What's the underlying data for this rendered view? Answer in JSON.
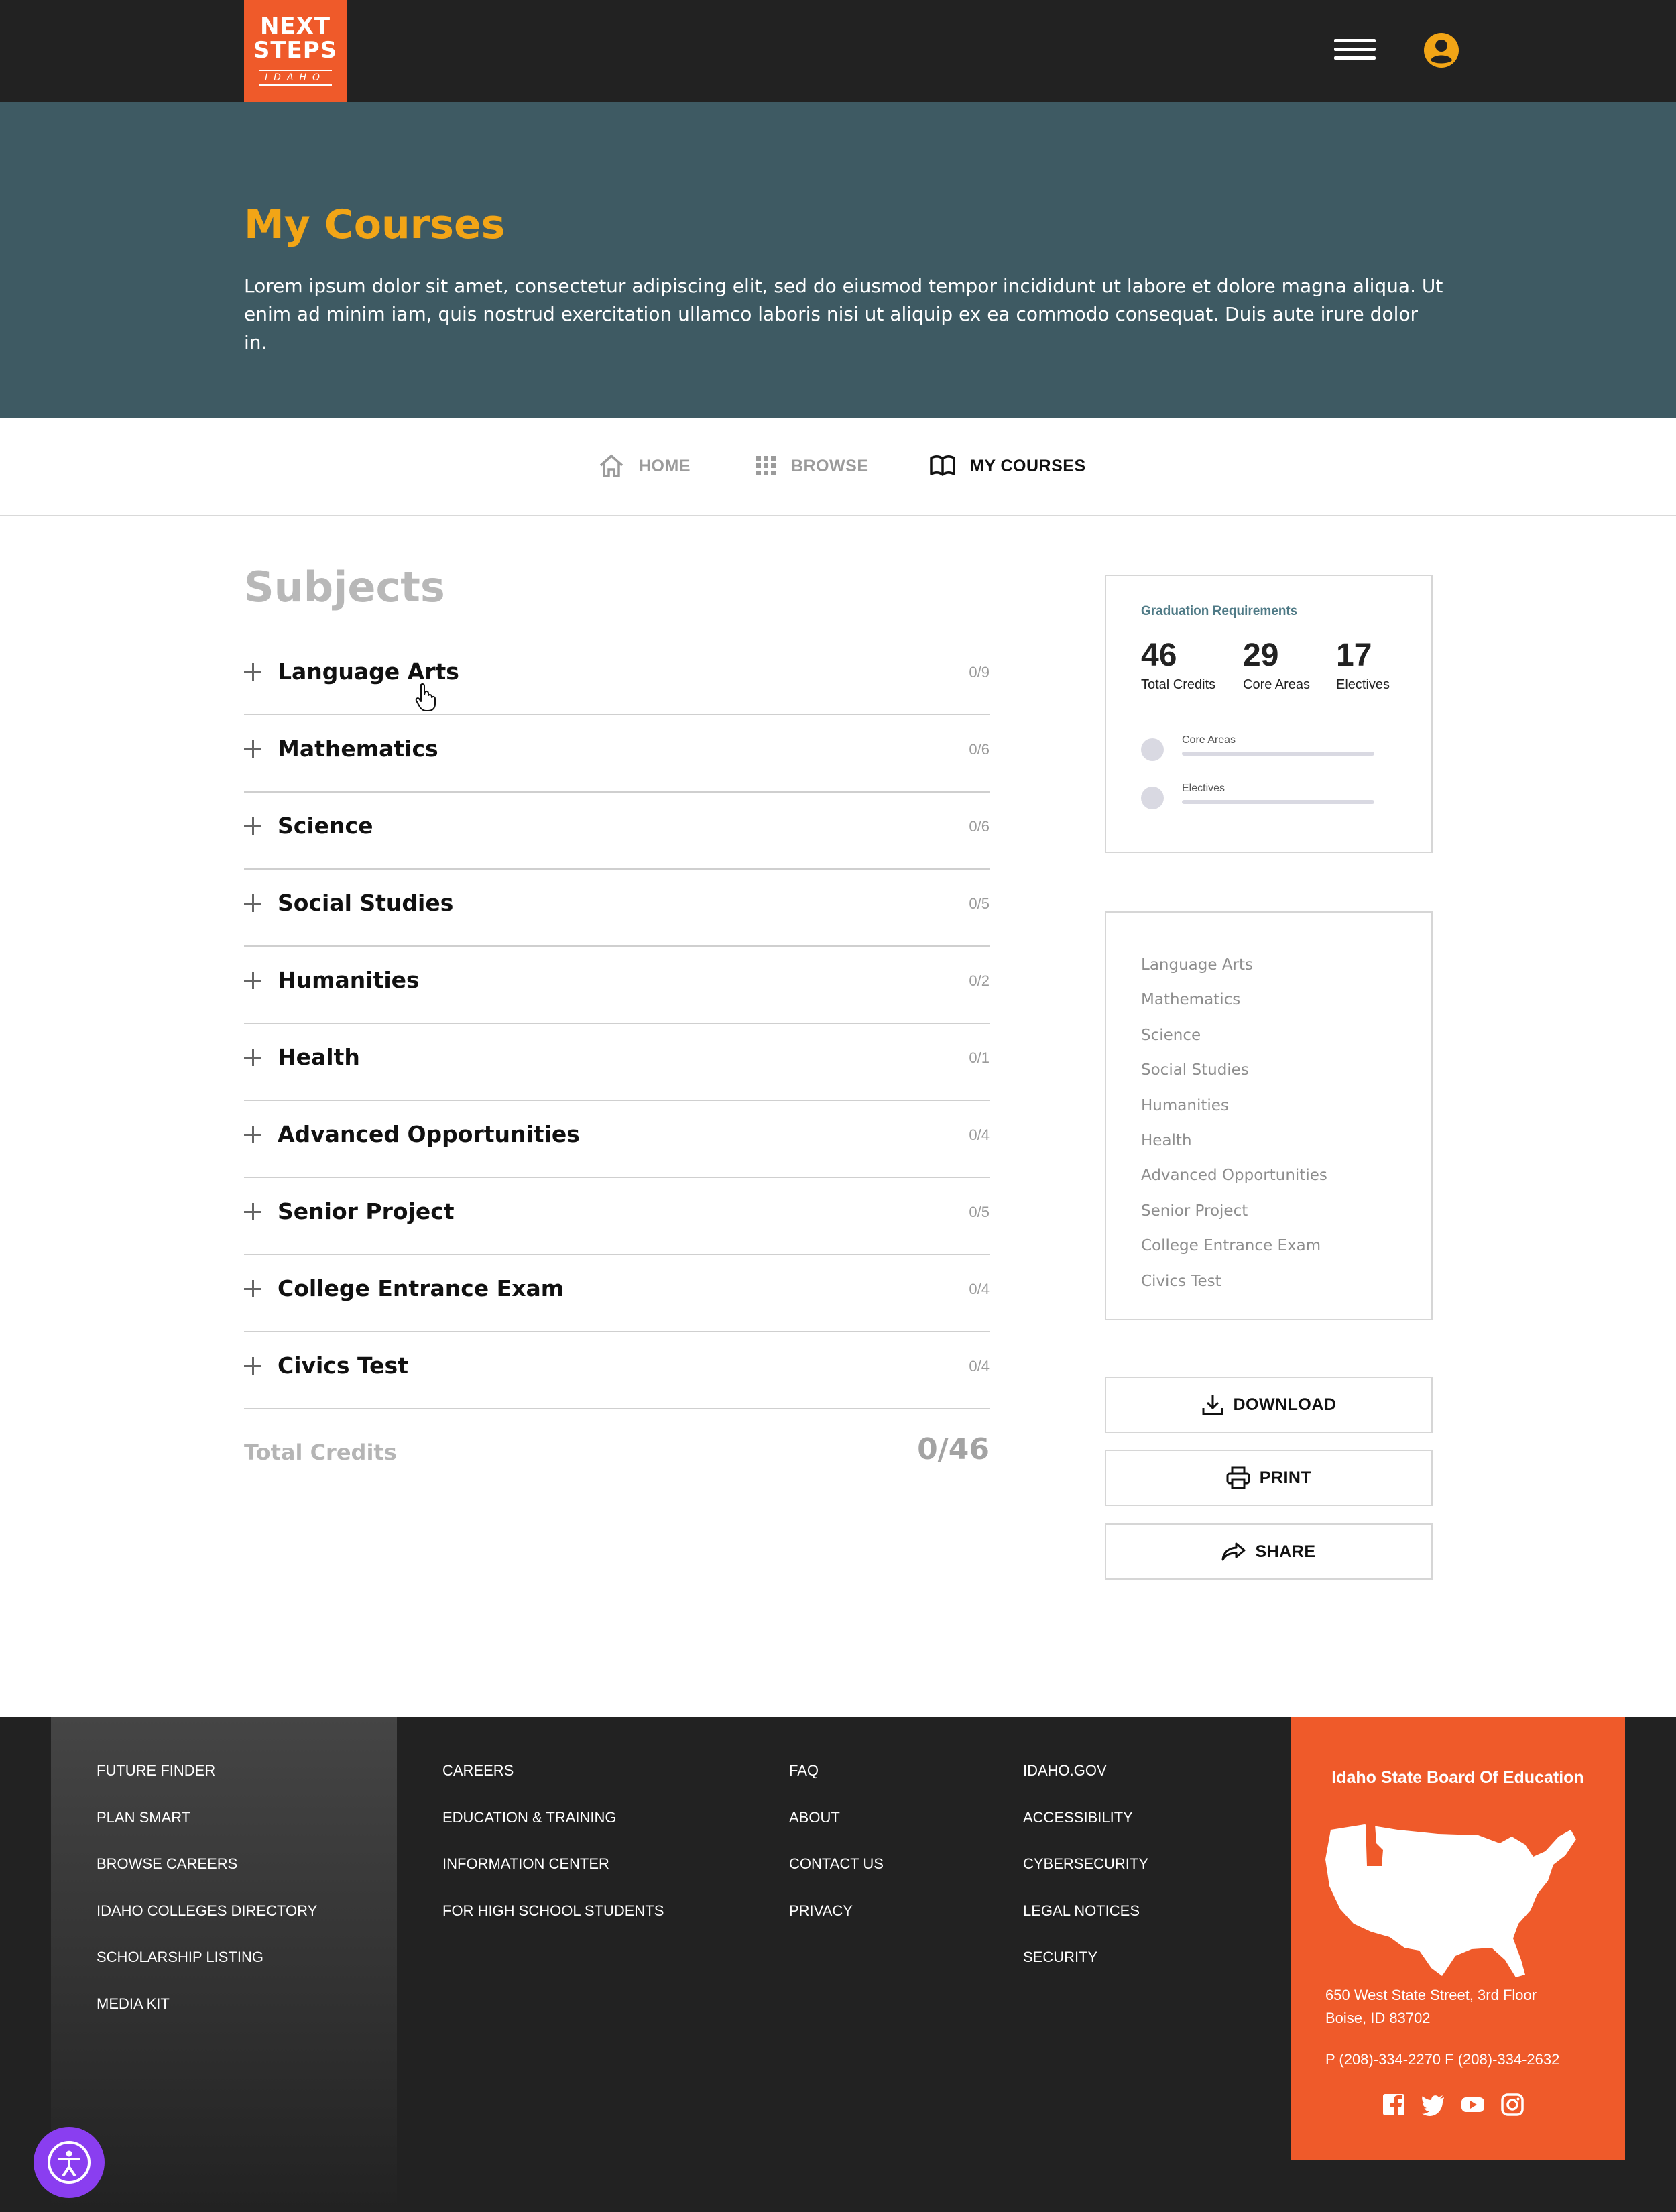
{
  "header": {
    "logo": {
      "line1": "NEXT",
      "line2": "STEPS",
      "line3": "IDAHO"
    },
    "menu_icon": "hamburger-icon",
    "user_icon": "user-circle-icon"
  },
  "hero": {
    "title": "My Courses",
    "description": "Lorem ipsum dolor sit amet, consectetur adipiscing elit, sed do eiusmod tempor incididunt ut labore et dolore magna aliqua. Ut enim ad minim iam, quis nostrud exercitation ullamco laboris nisi ut aliquip ex ea commodo consequat. Duis aute irure dolor in."
  },
  "tabs": [
    {
      "label": "HOME",
      "icon": "home-icon",
      "active": false
    },
    {
      "label": "BROWSE",
      "icon": "grid-icon",
      "active": false
    },
    {
      "label": "MY COURSES",
      "icon": "book-icon",
      "active": true
    }
  ],
  "subjects": {
    "title": "Subjects",
    "items": [
      {
        "name": "Language Arts",
        "count": "0/9"
      },
      {
        "name": "Mathematics",
        "count": "0/6"
      },
      {
        "name": "Science",
        "count": "0/6"
      },
      {
        "name": "Social Studies",
        "count": "0/5"
      },
      {
        "name": "Humanities",
        "count": "0/2"
      },
      {
        "name": "Health",
        "count": "0/1"
      },
      {
        "name": "Advanced Opportunities",
        "count": "0/4"
      },
      {
        "name": "Senior Project",
        "count": "0/5"
      },
      {
        "name": "College Entrance Exam",
        "count": "0/4"
      },
      {
        "name": "Civics Test",
        "count": "0/4"
      }
    ],
    "total_label": "Total Credits",
    "total_value": "0/46"
  },
  "graduation": {
    "title": "Graduation Requirements",
    "stats": [
      {
        "value": "46",
        "label": "Total Credits"
      },
      {
        "value": "29",
        "label": "Core Areas"
      },
      {
        "value": "17",
        "label": "Electives"
      }
    ],
    "progress": [
      {
        "label": "Core Areas",
        "fraction": 0
      },
      {
        "label": "Electives",
        "fraction": 0
      }
    ]
  },
  "subject_nav": [
    "Language Arts",
    "Mathematics",
    "Science",
    "Social Studies",
    "Humanities",
    "Health",
    "Advanced Opportunities",
    "Senior Project",
    "College Entrance Exam",
    "Civics Test"
  ],
  "actions": [
    {
      "label": "DOWNLOAD",
      "icon": "download-icon"
    },
    {
      "label": "PRINT",
      "icon": "printer-icon"
    },
    {
      "label": "SHARE",
      "icon": "share-icon"
    }
  ],
  "footer": {
    "col1": [
      "FUTURE FINDER",
      "PLAN SMART",
      "BROWSE CAREERS",
      "IDAHO COLLEGES DIRECTORY",
      "SCHOLARSHIP LISTING",
      "MEDIA KIT"
    ],
    "col2": [
      "CAREERS",
      "EDUCATION & TRAINING",
      "INFORMATION CENTER",
      "FOR HIGH SCHOOL STUDENTS"
    ],
    "col3": [
      "FAQ",
      "ABOUT",
      "CONTACT US",
      "PRIVACY"
    ],
    "col4": [
      "IDAHO.GOV",
      "ACCESSIBILITY",
      "CYBERSECURITY",
      "LEGAL NOTICES",
      "SECURITY"
    ],
    "board": {
      "title": "Idaho State Board Of Education",
      "address_line1": "650 West State Street, 3rd Floor",
      "address_line2": "Boise, ID 83702",
      "phone": "P (208)-334-2270  F (208)-334-2632",
      "socials": [
        "facebook-icon",
        "twitter-icon",
        "youtube-icon",
        "instagram-icon"
      ]
    }
  },
  "colors": {
    "brand_orange": "#ef5a2a",
    "title_gold": "#f2a516",
    "hero_teal": "#3e5a63",
    "header_dark": "#222222",
    "accessibility_purple": "#8a3ef0"
  }
}
